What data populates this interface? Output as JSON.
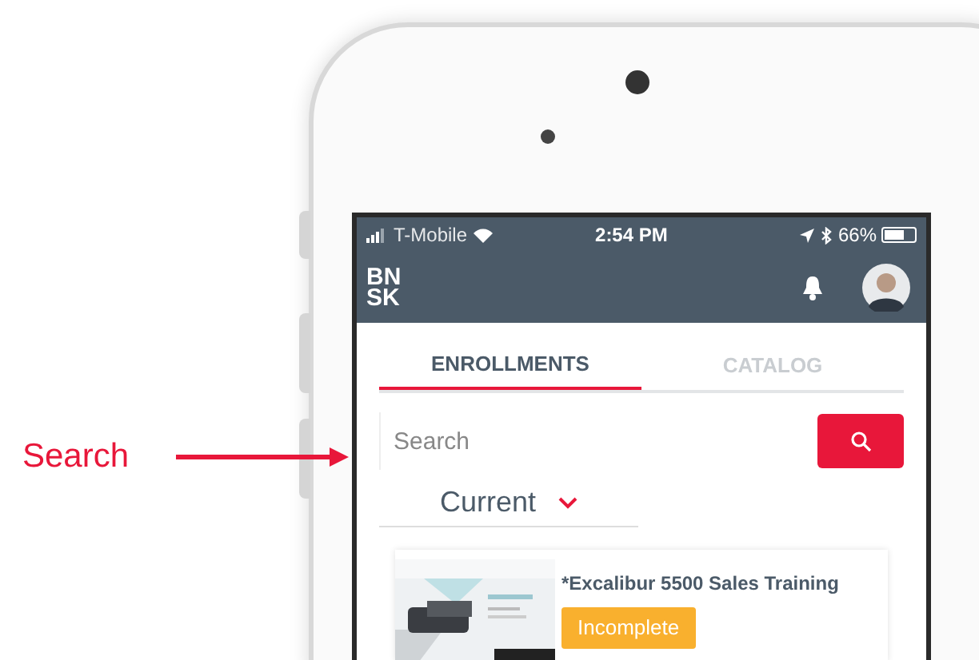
{
  "annotation": {
    "label": "Search"
  },
  "status_bar": {
    "carrier": "T-Mobile",
    "time": "2:54 PM",
    "battery": "66%"
  },
  "header": {
    "logo_lines": [
      "BN",
      "SK"
    ]
  },
  "tabs": [
    {
      "label": "ENROLLMENTS",
      "selected": true
    },
    {
      "label": "CATALOG",
      "selected": false
    }
  ],
  "search": {
    "placeholder": "Search"
  },
  "filter": {
    "value": "Current"
  },
  "enrollments": [
    {
      "title": "*Excalibur 5500 Sales Training",
      "status": "Incomplete"
    }
  ]
}
